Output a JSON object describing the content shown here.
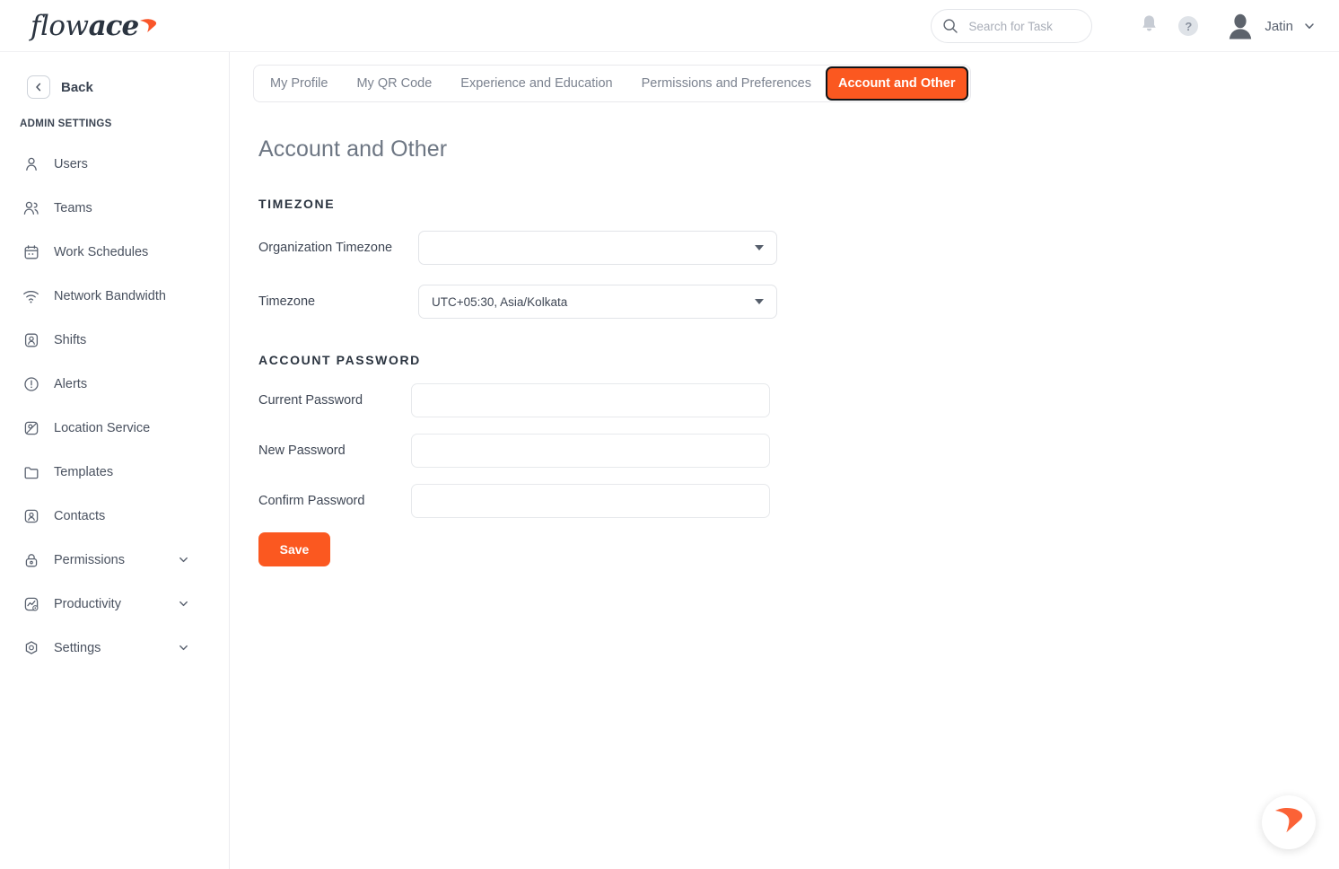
{
  "brand": {
    "logo_text_light": "flow",
    "logo_text_bold": "ace",
    "accent_color": "#fb5820",
    "logo_swoosh_icon": "flowace-swoosh-icon"
  },
  "header": {
    "search": {
      "placeholder": "Search for Task",
      "value": "",
      "icon": "search-icon"
    },
    "notifications_icon": "bell-icon",
    "help_icon": "question-mark-icon",
    "help_label": "?",
    "avatar_icon": "user-avatar-icon",
    "user_name": "Jatin",
    "user_caret_icon": "chevron-down-icon"
  },
  "sidebar": {
    "back_label": "Back",
    "back_icon": "chevron-left-icon",
    "section_caption": "ADMIN SETTINGS",
    "items": [
      {
        "label": "Users",
        "icon": "user-icon",
        "expandable": false
      },
      {
        "label": "Teams",
        "icon": "users-group-icon",
        "expandable": false
      },
      {
        "label": "Work Schedules",
        "icon": "calendar-icon",
        "expandable": false
      },
      {
        "label": "Network Bandwidth",
        "icon": "wifi-icon",
        "expandable": false
      },
      {
        "label": "Shifts",
        "icon": "badge-user-icon",
        "expandable": false
      },
      {
        "label": "Alerts",
        "icon": "alert-circle-icon",
        "expandable": false
      },
      {
        "label": "Location Service",
        "icon": "map-pin-icon",
        "expandable": false
      },
      {
        "label": "Templates",
        "icon": "folder-icon",
        "expandable": false
      },
      {
        "label": "Contacts",
        "icon": "contact-card-icon",
        "expandable": false
      },
      {
        "label": "Permissions",
        "icon": "lock-icon",
        "expandable": true
      },
      {
        "label": "Productivity",
        "icon": "chart-star-icon",
        "expandable": true
      },
      {
        "label": "Settings",
        "icon": "gear-hex-icon",
        "expandable": true
      }
    ],
    "caret_icon": "chevron-down-icon"
  },
  "main": {
    "tabs": [
      {
        "label": "My Profile",
        "active": false
      },
      {
        "label": "My QR Code",
        "active": false
      },
      {
        "label": "Experience and Education",
        "active": false
      },
      {
        "label": "Permissions and Preferences",
        "active": false
      },
      {
        "label": "Account and Other",
        "active": true
      }
    ],
    "page_title": "Account and Other",
    "timezone_section": {
      "heading": "TIMEZONE",
      "org_timezone_label": "Organization Timezone",
      "org_timezone_value": "",
      "timezone_label": "Timezone",
      "timezone_value": "UTC+05:30, Asia/Kolkata",
      "caret_icon": "caret-down-icon"
    },
    "password_section": {
      "heading": "ACCOUNT PASSWORD",
      "current_password_label": "Current Password",
      "current_password_value": "",
      "new_password_label": "New Password",
      "new_password_value": "",
      "confirm_password_label": "Confirm Password",
      "confirm_password_value": "",
      "save_label": "Save"
    }
  },
  "floating_widget": {
    "icon": "flowace-swoosh-icon"
  }
}
